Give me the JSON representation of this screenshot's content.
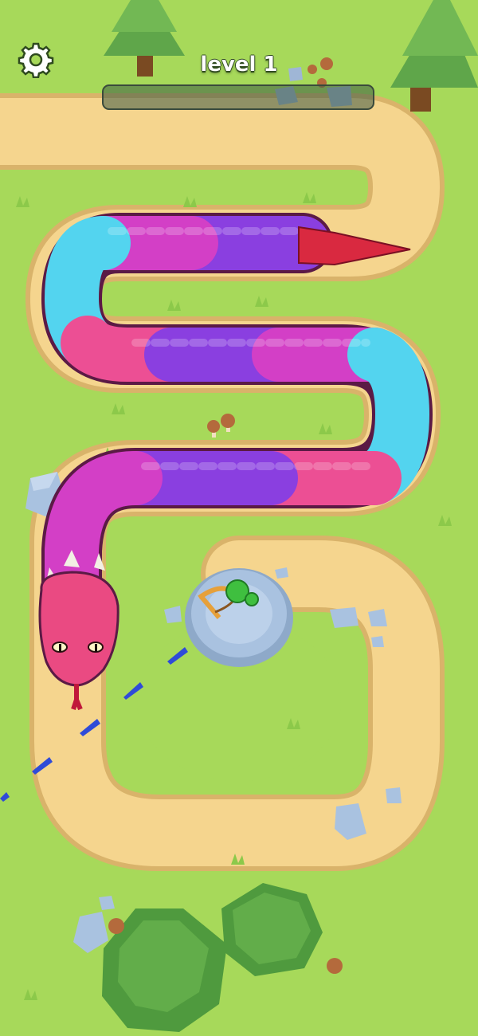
{
  "hud": {
    "level_label": "level 1",
    "progress": 0,
    "settings_icon": "gear-icon"
  },
  "colors": {
    "grass": "#a7d95a",
    "path": "#f5d58e",
    "path_edge": "#d9b36a",
    "snake_cyan": "#53d4ef",
    "snake_magenta": "#d33fc6",
    "snake_violet": "#8a3fe0",
    "snake_pink": "#ec4f94",
    "snake_head": "#ea4a82",
    "tail": "#d92940",
    "stone": "#a9c2e0",
    "arrow": "#2f4bd8",
    "player_head": "#3fbf3f",
    "crossbow": "#e6a03a"
  }
}
